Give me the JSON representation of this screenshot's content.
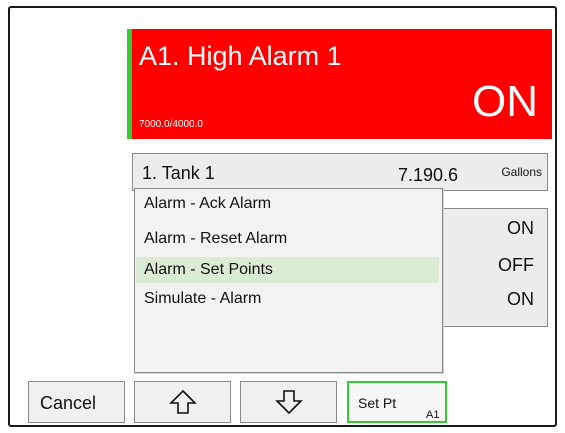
{
  "alarm": {
    "title": "A1. High Alarm 1",
    "values": "7000.0/4000.0",
    "state": "ON",
    "color": "#ff0000",
    "accent_color": "#33cc33"
  },
  "tank": {
    "name": "1. Tank 1",
    "value": "7.190.6",
    "unit": "Gallons"
  },
  "status_panel": {
    "values": [
      "ON",
      "OFF",
      "ON"
    ]
  },
  "menu": {
    "items": [
      "Alarm - Ack Alarm",
      "Alarm - Reset Alarm",
      "Alarm - Set Points",
      "Simulate - Alarm"
    ],
    "selected_index": 2,
    "highlight_color": "#dcebd3"
  },
  "buttons": {
    "cancel": "Cancel",
    "up_icon": "arrow-up-icon",
    "down_icon": "arrow-down-icon",
    "setpt": "Set Pt",
    "setpt_sub": "A1"
  }
}
